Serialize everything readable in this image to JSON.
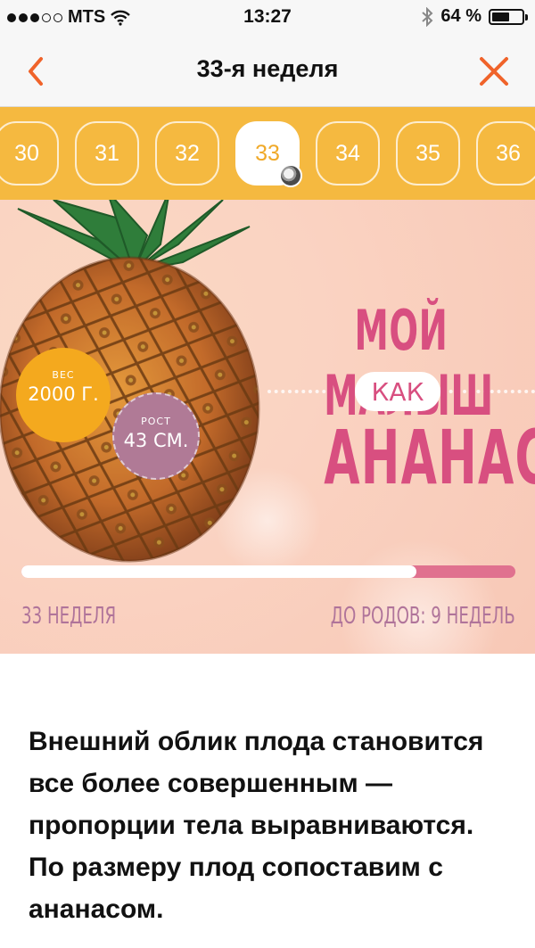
{
  "status_bar": {
    "carrier": "MTS",
    "time": "13:27",
    "battery_text": "64 %",
    "battery_level": 0.64,
    "signal_bars_filled": 3,
    "signal_bars_total": 5
  },
  "nav": {
    "title": "33-я неделя",
    "back_icon": "chevron-left-icon",
    "close_icon": "close-icon",
    "accent_color": "#f0632a"
  },
  "weeks": {
    "items": [
      "30",
      "31",
      "32",
      "33",
      "34",
      "35",
      "36"
    ],
    "selected": "33",
    "strip_color": "#f5b940"
  },
  "hero": {
    "weight_caption": "ВЕС",
    "weight_value": "2000 Г.",
    "height_caption": "РОСТ",
    "height_value": "43 СМ.",
    "headline_top": "МОЙ МАЛЫШ",
    "headline_middle": "КАК",
    "headline_bottom": "АНАНАС",
    "progress_fraction": 0.8,
    "week_label": "33 НЕДЕЛЯ",
    "remaining_label": "ДО РОДОВ: 9 НЕДЕЛЬ"
  },
  "article": {
    "paragraph_1": "Внешний облик плода становится все более совершенным — пропорции тела выравниваются.",
    "paragraph_2": "По размеру плод сопоставим с ананасом."
  }
}
